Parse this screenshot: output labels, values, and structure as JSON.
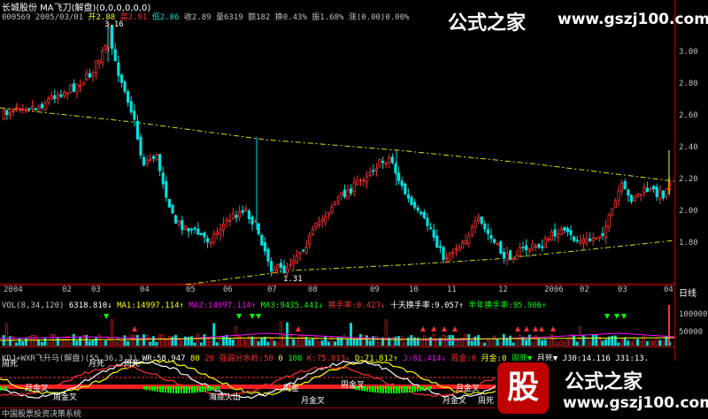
{
  "header": {
    "line1": "长城股份  MA飞刀(解盘)(0,0,0,0,0,0)",
    "line2": {
      "code_date": "000569 2005/03/01",
      "open": "开2.88",
      "high": "高2.91",
      "low": "低2.86",
      "close": "收2.89",
      "volume": "量6319",
      "change": "额182",
      "turnover": "换0.43%",
      "amplitude": "振1.68%",
      "rise": "涨(0.00)0.00%"
    }
  },
  "price_axis": {
    "ticks": [
      "3.00",
      "2.80",
      "2.60",
      "2.40",
      "2.20",
      "2.00",
      "1.80"
    ]
  },
  "annotations": {
    "high_label": "3.16",
    "low_label": "1.31"
  },
  "time_axis": {
    "labels": [
      "2004",
      "02",
      "03",
      "04",
      "05",
      "06",
      "07",
      "08",
      "09",
      "10",
      "11",
      "12",
      "2006",
      "02",
      "03",
      "04"
    ],
    "period": "日线"
  },
  "volume_panel": {
    "header": "VOL(8,34,120) 6318.810↓MA1:14997.114↑MA2:14997.114↑MA3:9435.441↓换手率:0.427↓十天换手率:9.057↑半年换手率:95.906↑",
    "header_parts": {
      "title": "VOL(8,34,120)",
      "vol": "6318.810↓",
      "ma1": "MA1:14997.114↑",
      "ma2": "MA2:14997.114↑",
      "ma3": "MA3:9435.441↓",
      "turnover": "换手率:0.427↓",
      "ten_day": "十天换手率:9.057↑",
      "half_year": "半年换手率:95.906↑"
    },
    "ticks": [
      "100000",
      "50000"
    ]
  },
  "indicator_panel": {
    "header_parts": {
      "title": "KDJ+WXR飞升马(解盘)(55,36,3,3)",
      "wr": "WR:58.947",
      "v80": "80",
      "v20": "20",
      "strong": "强弱分水岭:50",
      "v0": "0",
      "v100": "100",
      "k": "K:75.013↓",
      "d": "D:71.812↑",
      "j": "J:81.414↓",
      "week_gold": "周金:0",
      "month_gold": "月金:0",
      "week_dead": "周死▼",
      "month_dead": "月死▼",
      "j30": "J30:14.116",
      "j31": "J31:13."
    },
    "labels": [
      "周死",
      "月死",
      "周死",
      "月金叉",
      "周金叉",
      "海底火山",
      "周金",
      "月金叉",
      "周金叉",
      "月金叉",
      "月金叉",
      "周死"
    ],
    "footer": "中国股票投资决策系统"
  },
  "watermarks": {
    "top_title": "公式之家",
    "top_url": "www.gszj100.com",
    "bottom_badge": "股",
    "bottom_title": "公式之家",
    "bottom_url": "www.gszj100.com"
  },
  "colors": {
    "up": "#ff3030",
    "down": "#00e0e0",
    "ma_line": "#e0e000",
    "frame": "#a00000",
    "magenta": "#ff00ff",
    "green": "#00ff00"
  }
}
